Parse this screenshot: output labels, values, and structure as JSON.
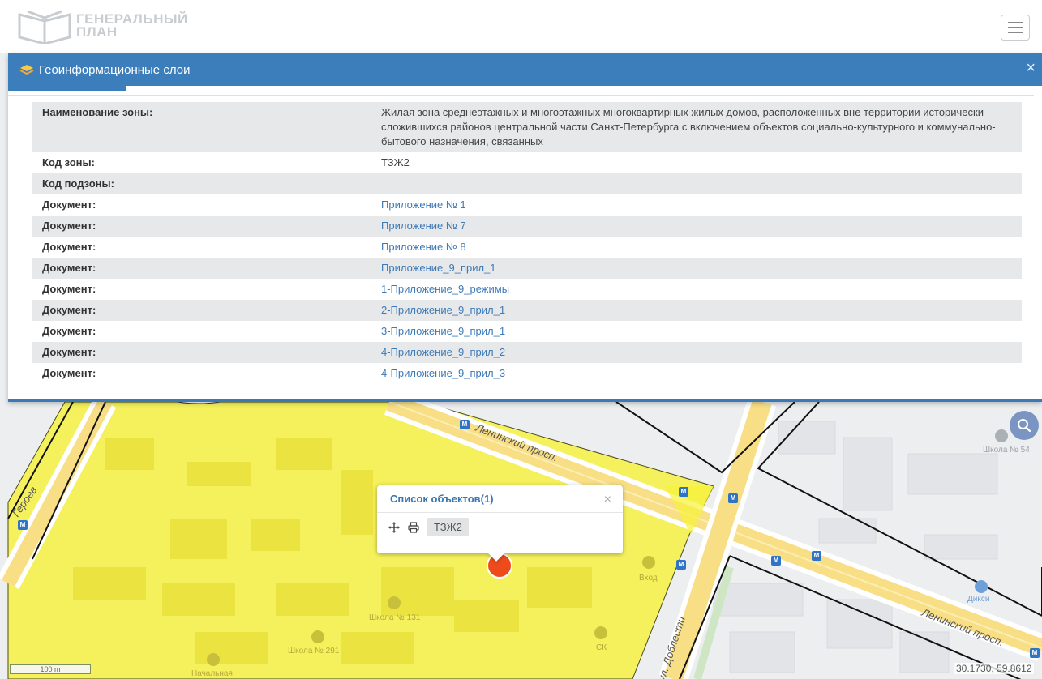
{
  "header": {
    "logo_line1": "ГЕНЕРАЛЬНЫЙ",
    "logo_line2": "ПЛАН"
  },
  "panel": {
    "title": "Геоинформационные слои",
    "close_label": "×",
    "rows": [
      {
        "key": "Наименование зоны:",
        "value": "Жилая зона среднеэтажных и многоэтажных многоквартирных жилых домов, расположенных вне территории исторически сложившихся районов центральной части Санкт-Петербурга с включением объектов социально-культурного и коммунально-бытового назначения, связанных"
      },
      {
        "key": "Код зоны:",
        "value": "ТЗЖ2"
      },
      {
        "key": "Код подзоны:",
        "value": ""
      },
      {
        "key": "Документ:",
        "value": "Приложение № 1"
      },
      {
        "key": "Документ:",
        "value": "Приложение № 7"
      },
      {
        "key": "Документ:",
        "value": "Приложение № 8"
      },
      {
        "key": "Документ:",
        "value": "Приложение_9_прил_1"
      },
      {
        "key": "Документ:",
        "value": "1-Приложение_9_режимы"
      },
      {
        "key": "Документ:",
        "value": "2-Приложение_9_прил_1"
      },
      {
        "key": "Документ:",
        "value": "3-Приложение_9_прил_1"
      },
      {
        "key": "Документ:",
        "value": "4-Приложение_9_прил_2"
      },
      {
        "key": "Документ:",
        "value": "4-Приложение_9_прил_3"
      }
    ]
  },
  "popup": {
    "title": "Список объектов(1)",
    "close_label": "×",
    "chip": "ТЗЖ2"
  },
  "map": {
    "street_leninsky_1": "Ленинский просп.",
    "street_leninsky_2": "Ленинский просп.",
    "street_geroev": "Героев",
    "street_doblesti": "ул. Доблести",
    "school_54": "Школа № 54",
    "school_131": "Школа № 131",
    "school_291": "Школа № 291",
    "dixy": "Дикси",
    "nachalnaya": "Начальная",
    "vhod": "Вход",
    "sk": "СК",
    "metro_symbol": "M",
    "scale_label": "100 m",
    "coords": "30.1730, 59.8612",
    "zone_color": "#f7f23a"
  }
}
